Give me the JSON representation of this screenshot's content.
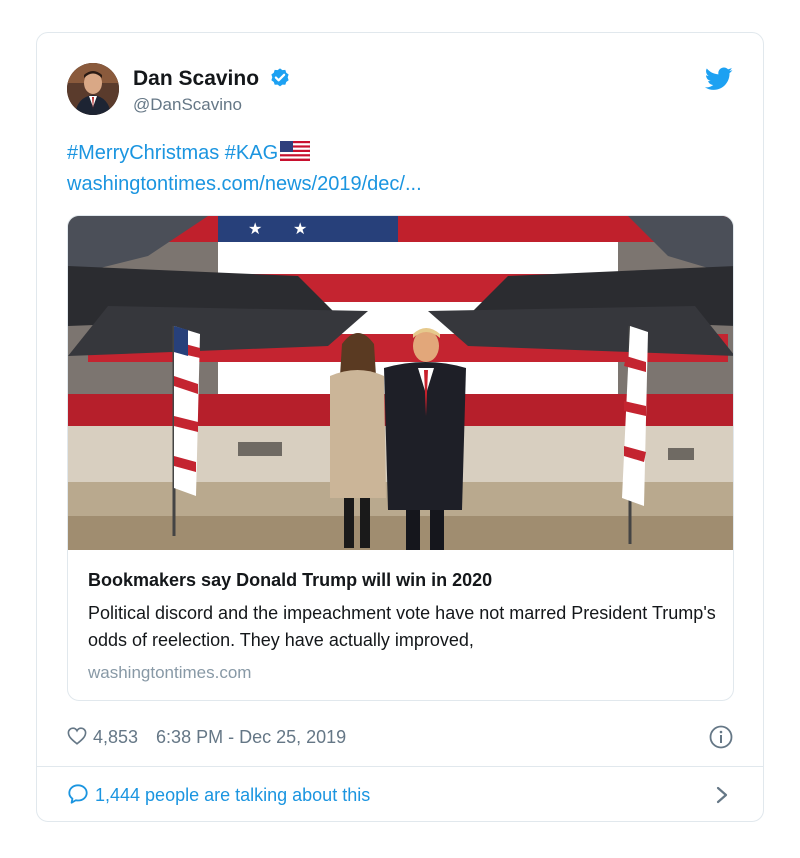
{
  "author": {
    "name": "Dan Scavino",
    "handle": "@DanScavino",
    "verified": true,
    "avatar_icon": "profile-photo"
  },
  "tweet": {
    "hashtags": "#MerryChristmas #KAG",
    "emoji": "us-flag-emoji",
    "link": "washingtontimes.com/news/2019/dec/..."
  },
  "card": {
    "image_icon": "news-photo-couple-in-hangar-with-flag",
    "title": "Bookmakers say Donald Trump will win in 2020",
    "description": "Political discord and the impeachment vote have not marred President Trump's odds of reelection. They have actually improved,",
    "domain": "washingtontimes.com"
  },
  "meta": {
    "likes": "4,853",
    "timestamp": "6:38 PM - Dec 25, 2019"
  },
  "footer": {
    "talking": "1,444 people are talking about this"
  },
  "colors": {
    "accent": "#1b95e0",
    "secondary_text": "#657786",
    "border": "#e1e8ed"
  }
}
